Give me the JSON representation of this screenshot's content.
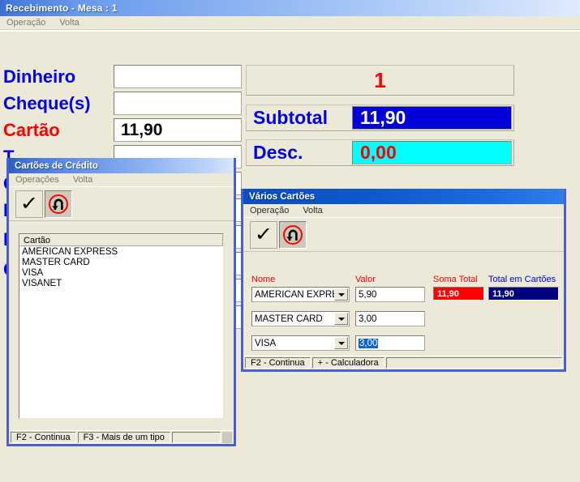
{
  "main_window": {
    "title": "Recebimento - Mesa  : 1",
    "menu": [
      "Operação",
      "Volta"
    ],
    "payment_rows": [
      {
        "label": "Dinheiro",
        "color": "blue",
        "value": ""
      },
      {
        "label": "Cheque(s)",
        "color": "blue",
        "value": ""
      },
      {
        "label": "Cartão",
        "color": "red",
        "value": "11,90"
      },
      {
        "label": "T",
        "color": "blue",
        "value": ""
      },
      {
        "label": "C",
        "color": "blue",
        "value": ""
      },
      {
        "label": "F",
        "color": "blue",
        "value": ""
      },
      {
        "label": "F",
        "color": "blue",
        "value": ""
      },
      {
        "label": "C",
        "color": "blue",
        "value": ""
      }
    ],
    "summary": {
      "count": "1",
      "subtotal_label": "Subtotal",
      "subtotal_value": "11,90",
      "desc_label": "Desc.",
      "desc_value": "0,00"
    }
  },
  "cartoes_window": {
    "title": "Cartões de Crédito",
    "menu": [
      "Operações",
      "Volta"
    ],
    "toolbar": {
      "confirm": "check-icon",
      "undo": "undo-icon"
    },
    "list": {
      "header": "Cartão",
      "items": [
        "AMERICAN EXPRESS",
        "MASTER CARD",
        "VISA",
        "VISANET"
      ]
    },
    "status": [
      "F2 - Continua",
      "F3 - Mais de um tipo"
    ]
  },
  "varios_window": {
    "title": "Vários Cartões",
    "menu": [
      "Operação",
      "Volta"
    ],
    "toolbar": {
      "confirm": "check-icon",
      "undo": "undo-icon"
    },
    "headers": {
      "nome": "Nome",
      "valor": "Valor",
      "soma_total": "Soma Total",
      "total_em_cartoes": "Total em Cartões"
    },
    "rows": [
      {
        "nome": "AMERICAN EXPRESS",
        "valor": "5,90",
        "selected": false
      },
      {
        "nome": "MASTER CARD",
        "valor": "3,00",
        "selected": false
      },
      {
        "nome": "VISA",
        "valor": "3,00",
        "selected": true
      }
    ],
    "soma_total": "11,90",
    "total_em_cartoes": "11,90",
    "status": [
      "F2 - Continua",
      "+ - Calculadora"
    ]
  },
  "colors": {
    "title_blue": "#2c5bc4",
    "face": "#ece9d8",
    "label_blue": "#0000ee",
    "label_red": "#ff0000",
    "subtotal_bg": "#0000d8",
    "desc_bg": "#00ffff",
    "soma_total_bg": "#ff0000",
    "total_cartoes_bg": "#000080",
    "selection_blue": "#1265d0"
  }
}
